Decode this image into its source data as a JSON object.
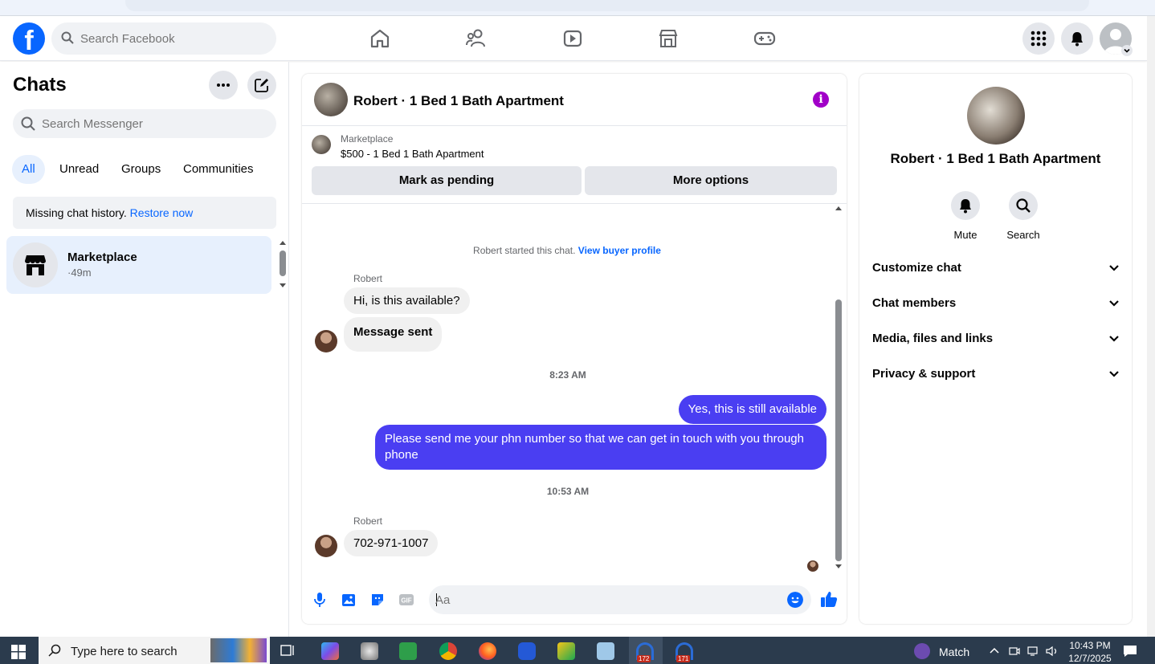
{
  "browser": {
    "url": "facebook.com/messages/t/..."
  },
  "topbar": {
    "search_placeholder": "Search Facebook",
    "nav_icons": [
      "home-icon",
      "friends-icon",
      "video-icon",
      "marketplace-icon",
      "gaming-icon"
    ],
    "right_icons": [
      "menu-grid-icon",
      "notifications-icon",
      "account-avatar"
    ]
  },
  "sidebar": {
    "title": "Chats",
    "search_placeholder": "Search Messenger",
    "filters": [
      "All",
      "Unread",
      "Groups",
      "Communities"
    ],
    "active_filter": "All",
    "missing_text": "Missing chat history.",
    "restore_link": "Restore now",
    "chats": [
      {
        "name": "Marketplace",
        "time": "·49m"
      }
    ]
  },
  "conversation": {
    "title": "Robert · 1 Bed 1 Bath Apartment",
    "banner_label": "Marketplace",
    "banner_item": "$500 - 1 Bed 1 Bath Apartment",
    "mark_pending_label": "Mark as pending",
    "more_options_label": "More options",
    "system_text": "Robert started this chat.",
    "buyer_profile_link": "View buyer profile",
    "messages": {
      "sender_1": "Robert",
      "in_1": "Hi, is this available?",
      "in_2": "Message sent",
      "time_1": "8:23 AM",
      "out_1": "Yes, this is still available",
      "out_2": "Please send me your phn number so that we can get in touch with you through phone",
      "time_2": "10:53 AM",
      "sender_2": "Robert",
      "in_3": "702-971-1007"
    },
    "composer_placeholder": "Aa"
  },
  "details": {
    "name": "Robert · 1 Bed 1 Bath Apartment",
    "actions": [
      "Mute",
      "Search"
    ],
    "sections": [
      "Customize chat",
      "Chat members",
      "Media, files and links",
      "Privacy & support"
    ]
  },
  "taskbar": {
    "search_text": "Type here to search",
    "match_label": "Match",
    "time": "10:43 PM",
    "date": "12/7/2025",
    "badge_1": "172",
    "badge_2": "171"
  },
  "colors": {
    "facebook_blue": "#0866ff",
    "outgoing_bubble": "#4a3ef2",
    "incoming_bubble": "#f0f0f0",
    "info_icon": "#a100c8"
  }
}
